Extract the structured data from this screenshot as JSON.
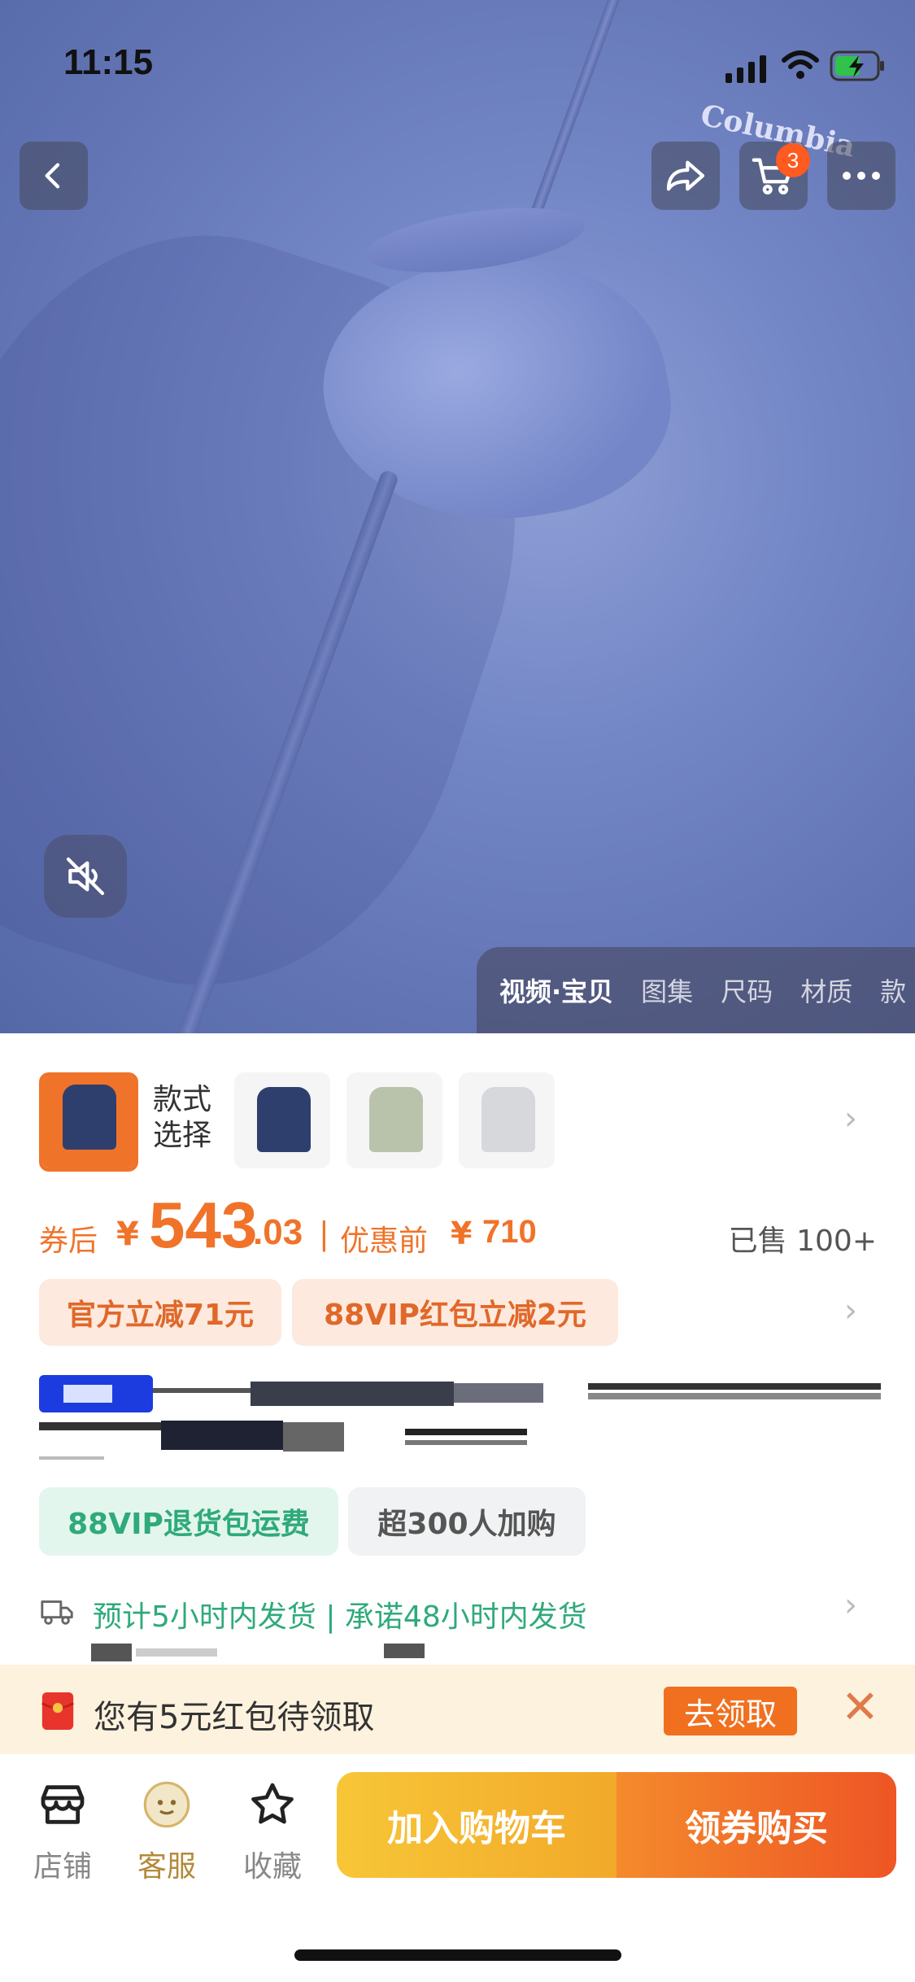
{
  "status_bar": {
    "time": "11:15"
  },
  "hero": {
    "brand_watermark": "Columbia",
    "cart_badge": "3",
    "media_tabs": [
      "视频·宝贝",
      "图集",
      "尺码",
      "材质",
      "款"
    ]
  },
  "variants": {
    "label_line1": "款式",
    "label_line2": "选择",
    "colors": [
      "#f0732a",
      "#2e3f6e",
      "#b9c3ab",
      "#d7d8dc"
    ]
  },
  "price": {
    "after_coupon_label": "券后",
    "currency": "¥",
    "integer": "543",
    "decimal": ".03",
    "separator": "|",
    "before_label": "优惠前",
    "original": "710",
    "sold": "已售 100+"
  },
  "promos": [
    "官方立减71元",
    "88VIP红包立减2元"
  ],
  "tags": [
    "88VIP退货包运费",
    "超300人加购"
  ],
  "shipping": "预计5小时内发货 | 承诺48小时内发货",
  "red_packet": {
    "text": "您有5元红包待领取",
    "button": "去领取",
    "close": "✕"
  },
  "bottom_nav": {
    "shop": "店铺",
    "service": "客服",
    "favorite": "收藏",
    "add_cart": "加入购物车",
    "buy": "领券购买"
  },
  "colors": {
    "accent_orange": "#f0732a",
    "green": "#2faa7a",
    "cart_yellow": "#f5b52a",
    "buy_orange": "#ef5a26"
  }
}
